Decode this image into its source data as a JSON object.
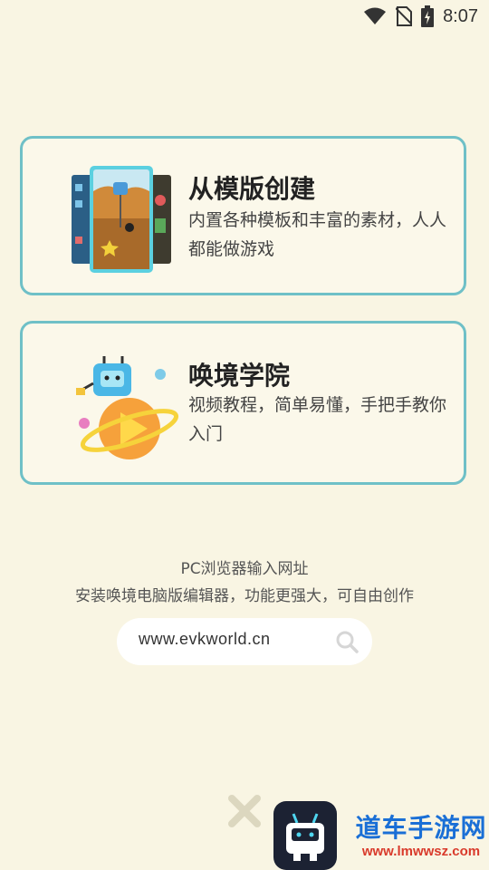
{
  "status_bar": {
    "time": "8:07"
  },
  "cards": {
    "template": {
      "title": "从模版创建",
      "desc": "内置各种模板和丰富的素材，人人都能做游戏"
    },
    "academy": {
      "title": "唤境学院",
      "desc": "视频教程，简单易懂，手把手教你入门"
    }
  },
  "pc_info": {
    "line1": "PC浏览器输入网址",
    "line2": "安装唤境电脑版编辑器，功能更强大，可自由创作"
  },
  "url_box": {
    "url": "www.evkworld.cn"
  },
  "watermark": {
    "name": "道车手游网",
    "url": "www.lmwwsz.com"
  },
  "colors": {
    "accent": "#6fc0c7",
    "background": "#f9f5e3"
  }
}
